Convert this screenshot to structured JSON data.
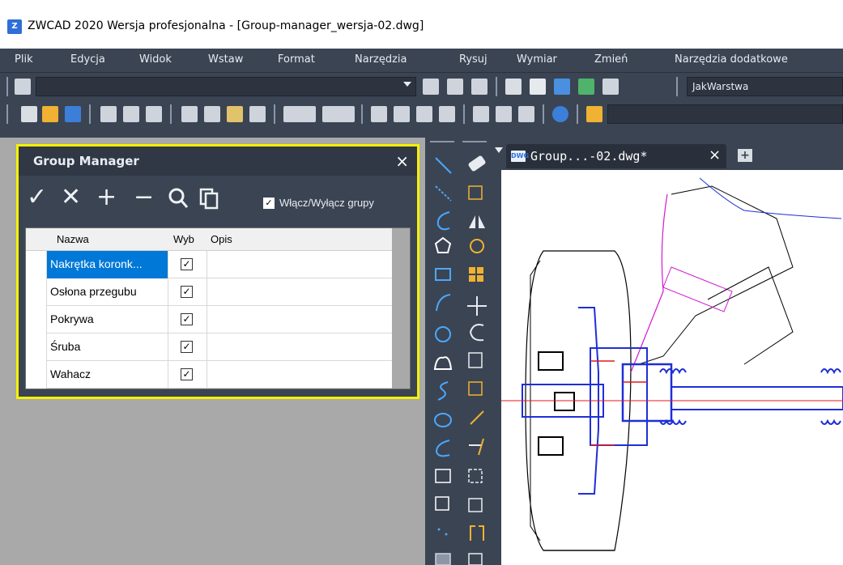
{
  "window": {
    "title": "ZWCAD 2020 Wersja profesjonalna - [Group-manager_wersja-02.dwg]",
    "logo_icon": "zwcad-logo-icon"
  },
  "menu": [
    "Plik",
    "Edycja",
    "Widok",
    "Wstaw",
    "Format",
    "Narzędzia",
    "Rysuj",
    "Wymiar",
    "Zmień",
    "Narzędzia dodatkowe"
  ],
  "toolbar": {
    "layer_combo_value": "",
    "linetype_combo_value": "JakWarstwa",
    "text_style_combo_value": ""
  },
  "group_manager": {
    "title": "Group Manager",
    "close_glyph": "×",
    "tools": {
      "apply": "✓",
      "cancel": "✕",
      "add": "+",
      "remove": "−",
      "find": "🔍",
      "copy": "❐"
    },
    "toggle_checked": "✓",
    "toggle_label": "Włącz/Wyłącz grupy",
    "columns": [
      "Nazwa",
      "Wyb",
      "Opis"
    ],
    "rows": [
      {
        "name": "Nakrętka koronk...",
        "selectable": "✓",
        "description": ""
      },
      {
        "name": "Osłona przegubu",
        "selectable": "✓",
        "description": ""
      },
      {
        "name": "Pokrywa",
        "selectable": "✓",
        "description": ""
      },
      {
        "name": "Śruba",
        "selectable": "✓",
        "description": ""
      },
      {
        "name": "Wahacz",
        "selectable": "✓",
        "description": ""
      }
    ]
  },
  "document_tab": {
    "label": "Group...-02.dwg*",
    "close_glyph": "×",
    "icon": "DWG",
    "add_glyph": "+"
  },
  "colors": {
    "ui_dark": "#3b4453",
    "highlight_border": "#f6f100",
    "selection": "#0078d7",
    "drawing_blue": "#1e2fd6",
    "drawing_red": "#e0191d",
    "drawing_magenta": "#d11ad1"
  }
}
